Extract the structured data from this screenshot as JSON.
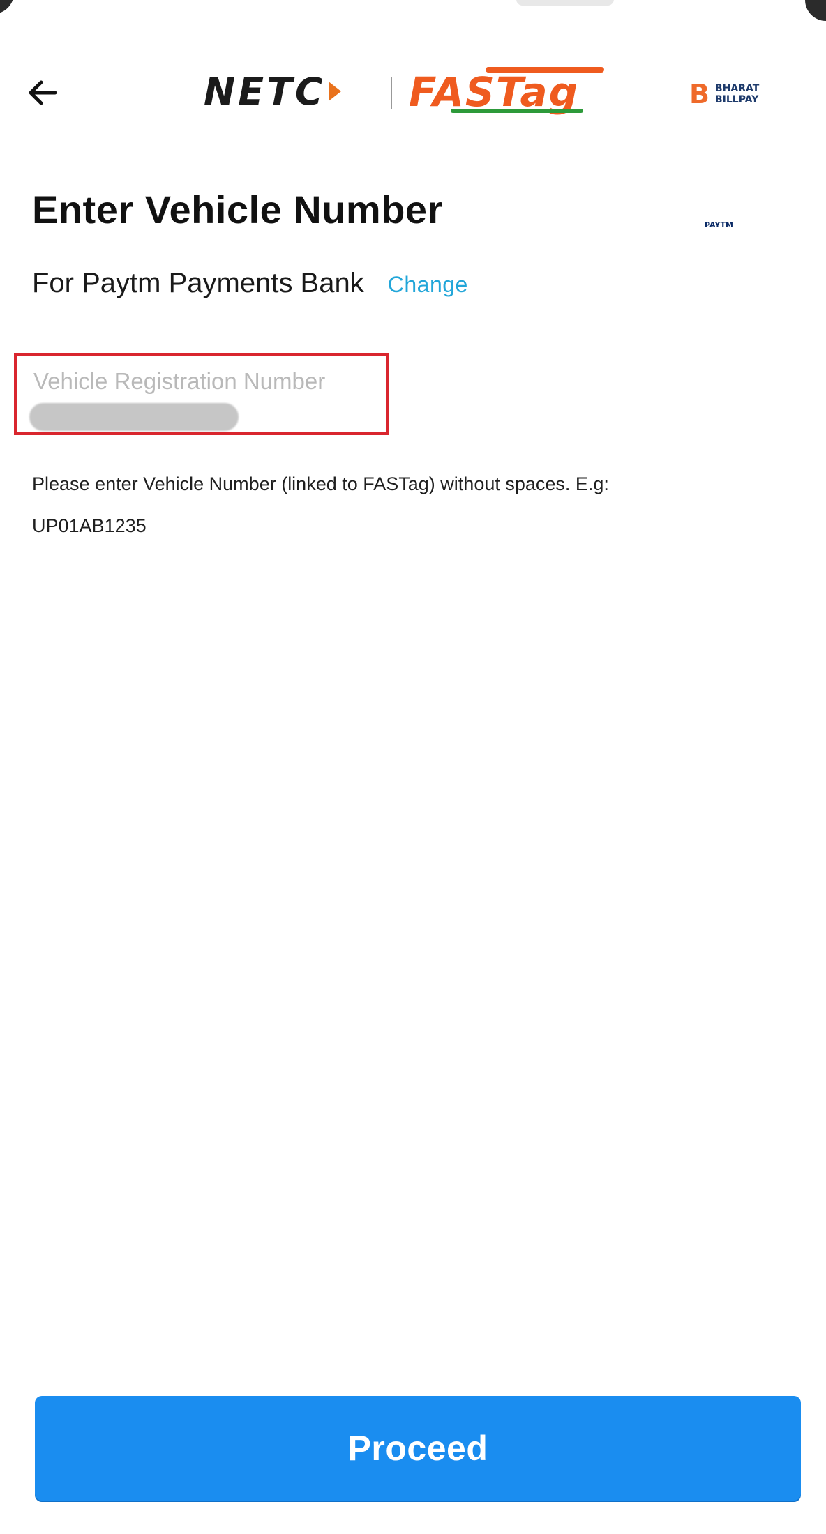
{
  "header": {
    "back_icon": "arrow-left-icon",
    "logos": {
      "netc": "NETC",
      "fastag": "FASTag",
      "bbps_letter": "B",
      "bbps_line1": "BHARAT",
      "bbps_line2": "BILLPAY"
    }
  },
  "page": {
    "title": "Enter Vehicle Number",
    "bank_label": "For Paytm Payments Bank",
    "change_label": "Change",
    "partner_logo": {
      "dark": "PAYTM",
      "light": ""
    }
  },
  "vehicle_input": {
    "label": "Vehicle Registration Number",
    "value": "",
    "value_redacted": true
  },
  "helper": {
    "line1": "Please enter Vehicle Number (linked to FASTag) without spaces. E.g:",
    "line2": "UP01AB1235"
  },
  "footer": {
    "proceed_label": "Proceed"
  },
  "colors": {
    "accent": "#1a8df0",
    "link": "#22a6d9",
    "highlight_border": "#d9262e",
    "fastag_orange": "#ef5b1f",
    "fastag_green": "#2d9a3a"
  }
}
